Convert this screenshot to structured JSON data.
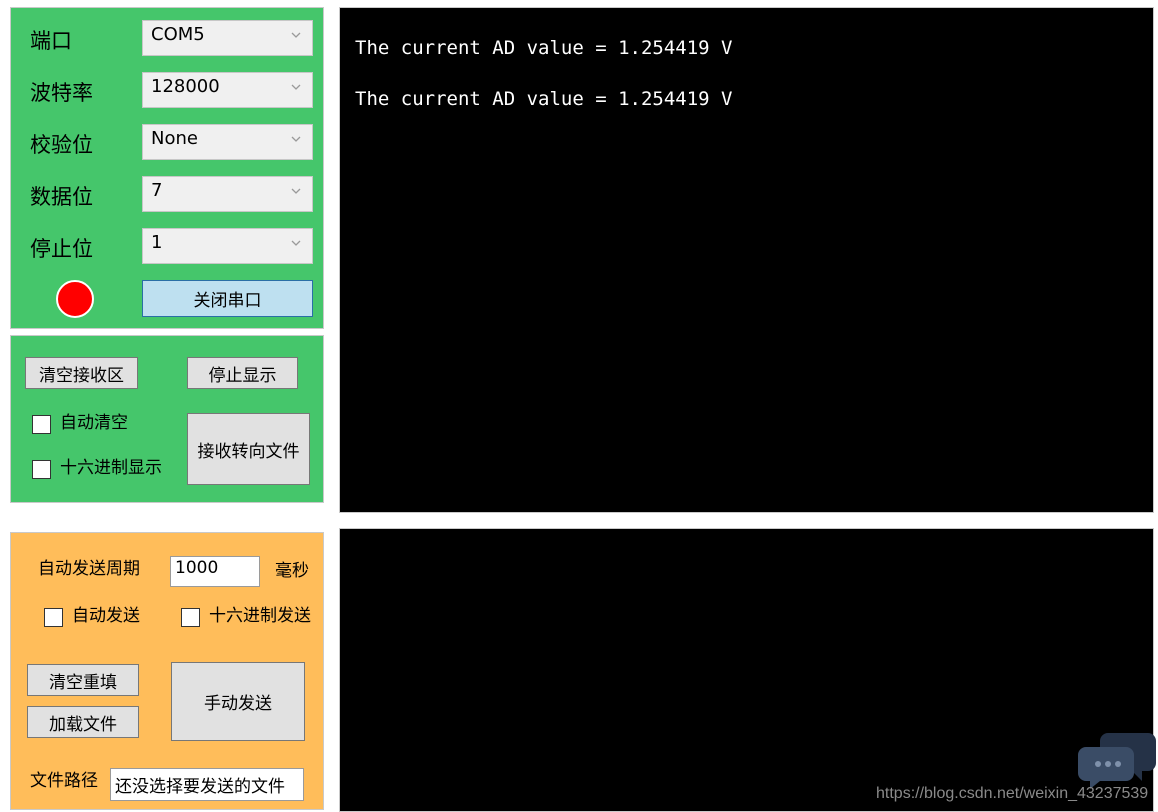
{
  "serial_settings": {
    "port_label": "端口",
    "port_value": "COM5",
    "baud_label": "波特率",
    "baud_value": "128000",
    "parity_label": "校验位",
    "parity_value": "None",
    "databits_label": "数据位",
    "databits_value": "7",
    "stopbits_label": "停止位",
    "stopbits_value": "1",
    "status_color": "#ff0000",
    "close_port_button": "关闭串口"
  },
  "receive_controls": {
    "clear_button": "清空接收区",
    "stop_display_button": "停止显示",
    "auto_clear_label": "自动清空",
    "hex_display_label": "十六进制显示",
    "redirect_file_button": "接收转向文件"
  },
  "send_controls": {
    "period_label": "自动发送周期",
    "period_value": "1000",
    "period_unit": "毫秒",
    "auto_send_label": "自动发送",
    "hex_send_label": "十六进制发送",
    "clear_refill_button": "清空重填",
    "load_file_button": "加载文件",
    "manual_send_button": "手动发送",
    "file_path_label": "文件路径",
    "file_path_value": "还没选择要发送的文件"
  },
  "receive_terminal": {
    "lines": [
      "The current AD value = 1.254419 V",
      "The current AD value = 1.254419 V"
    ]
  },
  "watermark": "https://blog.csdn.net/weixin_43237539",
  "colors": {
    "settings_panel": "#45c66b",
    "send_panel": "#ffbd5a",
    "terminal_bg": "#000000"
  }
}
